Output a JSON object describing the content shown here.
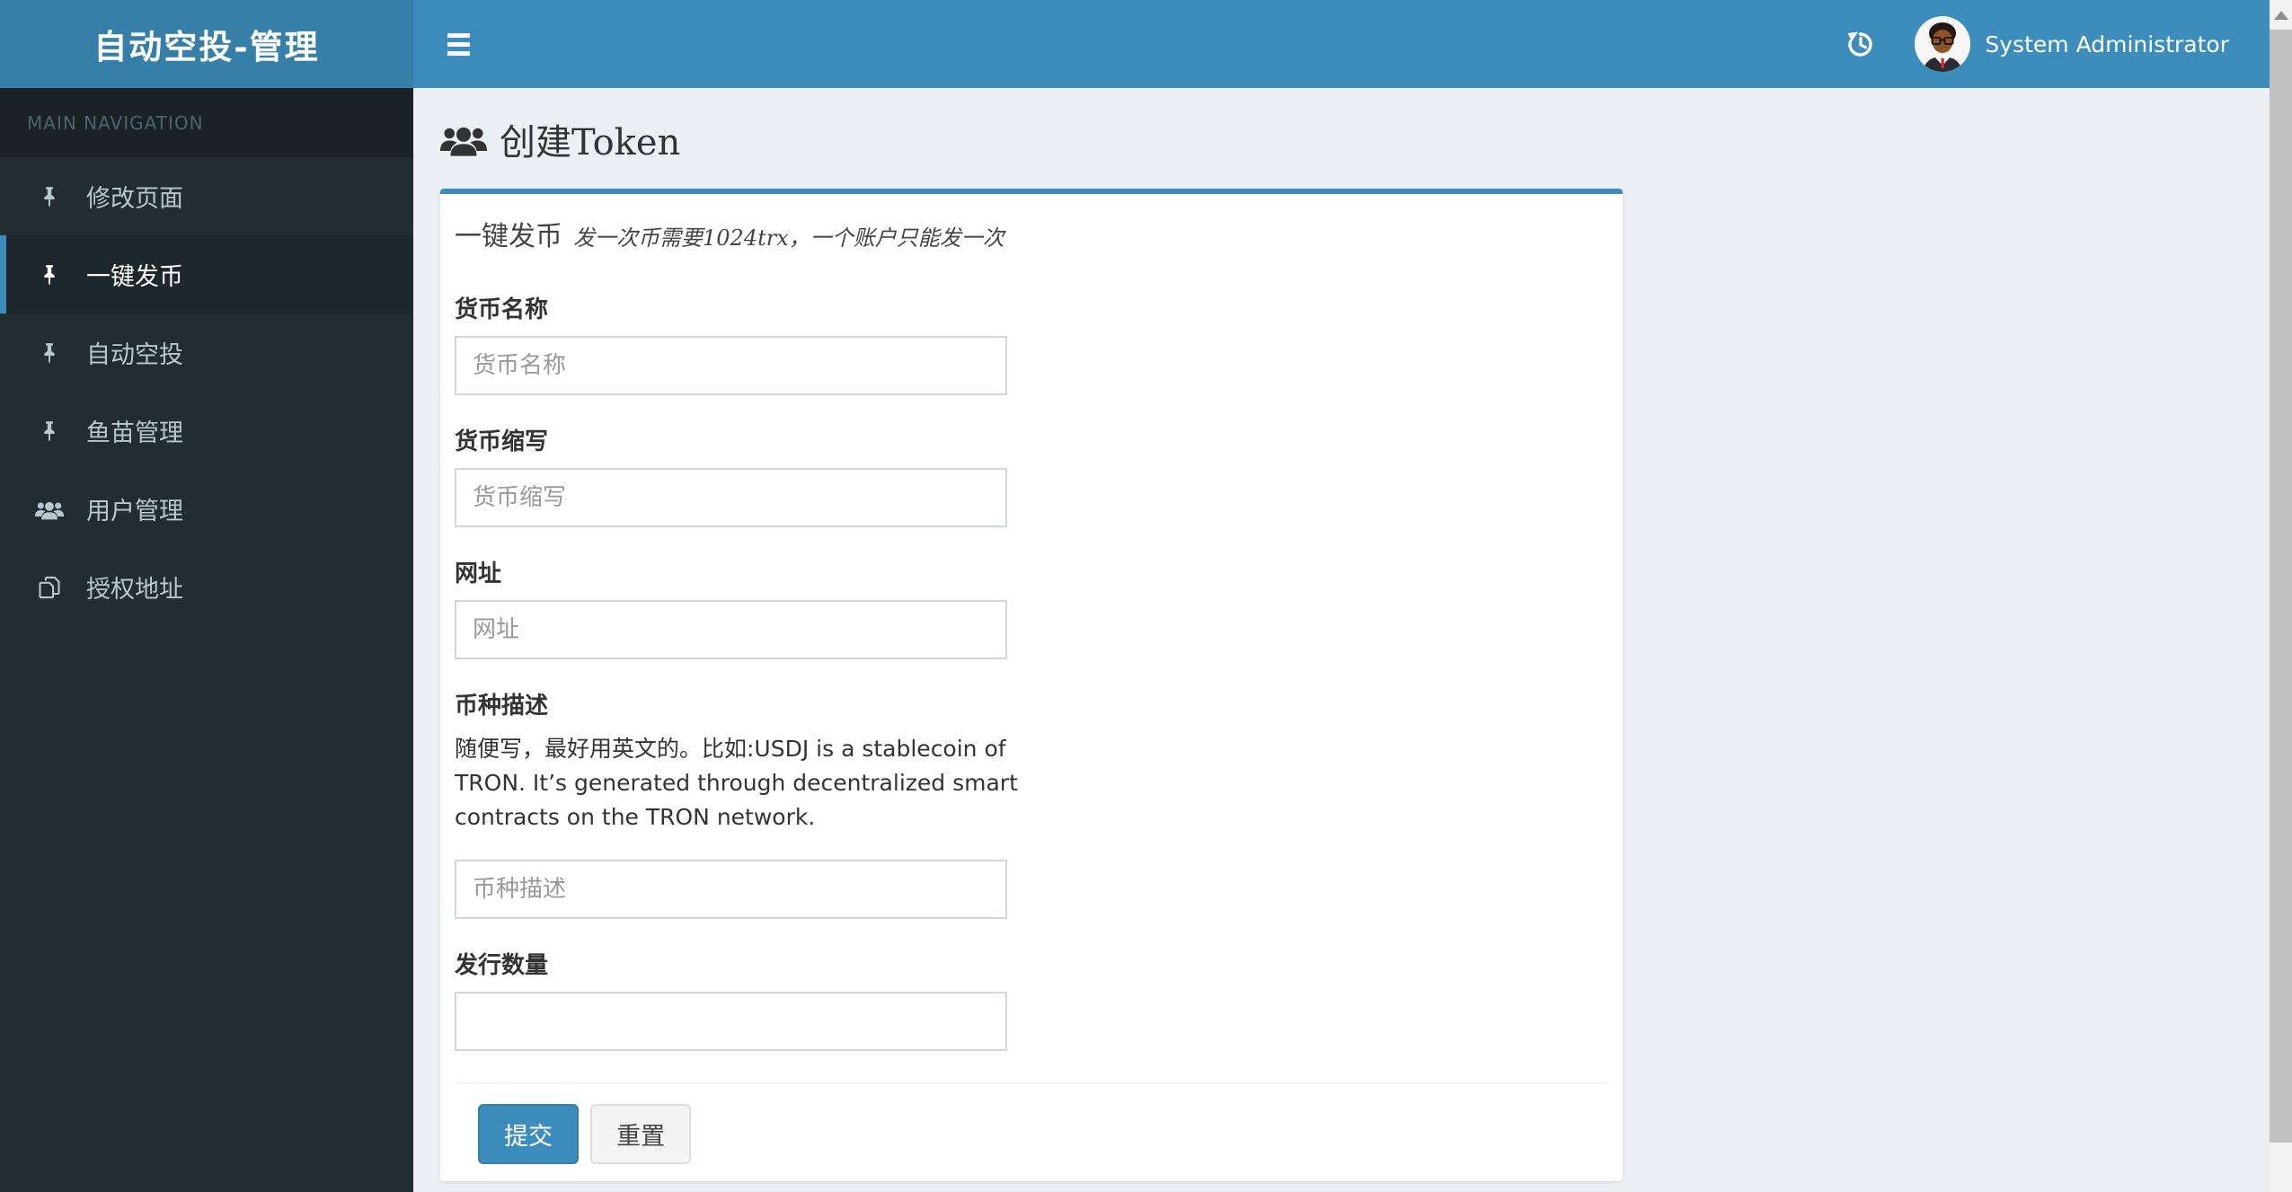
{
  "navbar": {
    "logo": "自动空投-管理",
    "user_name": "System Administrator"
  },
  "sidebar": {
    "header": "MAIN NAVIGATION",
    "items": [
      {
        "label": "修改页面",
        "icon": "pushpin-icon",
        "active": false
      },
      {
        "label": "一键发币",
        "icon": "pushpin-icon",
        "active": true
      },
      {
        "label": "自动空投",
        "icon": "pushpin-icon",
        "active": false
      },
      {
        "label": "鱼苗管理",
        "icon": "pushpin-icon",
        "active": false
      },
      {
        "label": "用户管理",
        "icon": "users-icon",
        "active": false
      },
      {
        "label": "授权地址",
        "icon": "copy-icon",
        "active": false
      }
    ]
  },
  "content": {
    "page_title": "创建Token",
    "box": {
      "title": "一键发币",
      "note": "发一次币需要1024trx，一个账户只能发一次",
      "fields": [
        {
          "label": "货币名称",
          "placeholder": "货币名称"
        },
        {
          "label": "货币缩写",
          "placeholder": "货币缩写"
        },
        {
          "label": "网址",
          "placeholder": "网址"
        },
        {
          "label": "币种描述",
          "placeholder": "币种描述",
          "help": "随便写，最好用英文的。比如:USDJ is a stablecoin of TRON. It’s generated through decentralized smart contracts on the TRON network."
        },
        {
          "label": "发行数量",
          "placeholder": ""
        }
      ],
      "submit_label": "提交",
      "reset_label": "重置"
    }
  },
  "colors": {
    "accent": "#3c8dbc",
    "logo_bg": "#367fa9",
    "sidebar_bg": "#222d32",
    "sidebar_active_bg": "#1e282c",
    "content_bg": "#ecf0f5",
    "input_border": "#d2d6de"
  }
}
